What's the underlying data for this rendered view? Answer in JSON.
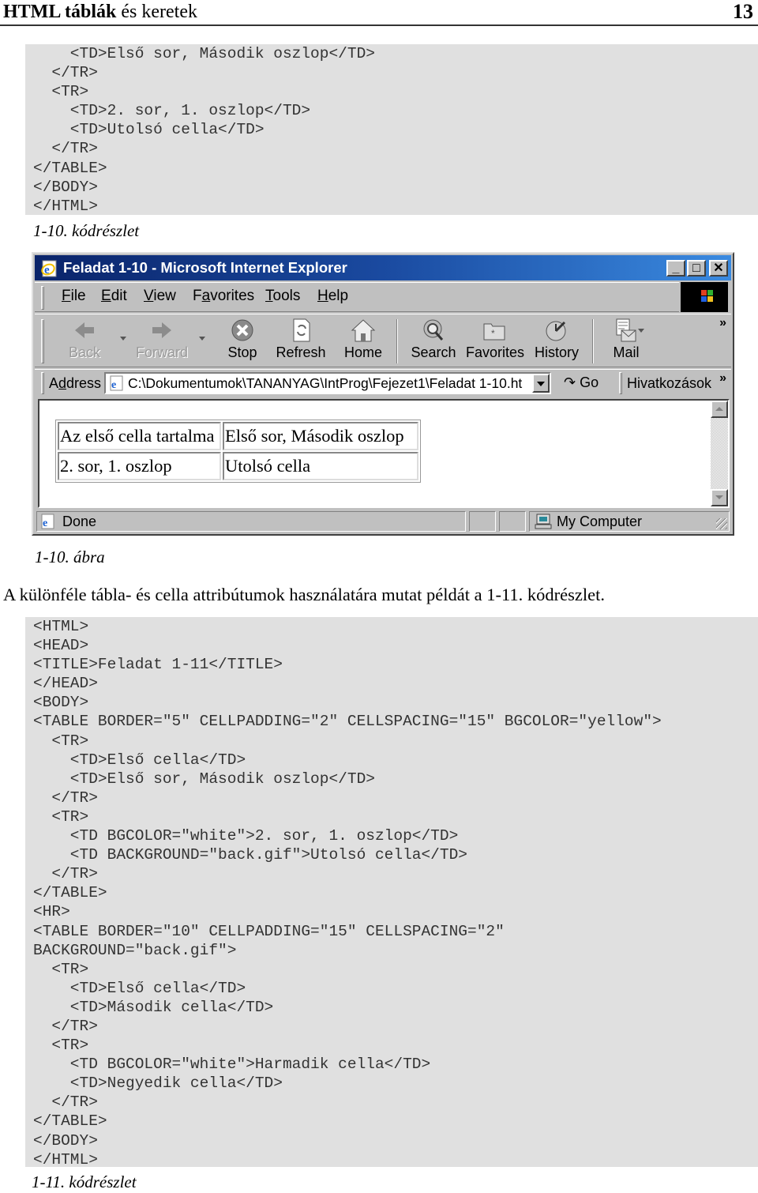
{
  "page_header": {
    "title_bold": "HTML táblák",
    "title_rest": " és keretek",
    "page_number": "13"
  },
  "code_1_10_tail": [
    "    <TD>Első sor, Második oszlop</TD>",
    "  </TR>",
    "  <TR>",
    "    <TD>2. sor, 1. oszlop</TD>",
    "    <TD>Utolsó cella</TD>",
    "  </TR>",
    "</TABLE>",
    "</BODY>",
    "</HTML>"
  ],
  "caption_code_1_10": "1-10. kódrészlet",
  "browser": {
    "title": "Feladat 1-10 - Microsoft Internet Explorer",
    "menu": [
      {
        "label": "File",
        "accel": "F"
      },
      {
        "label": "Edit",
        "accel": "E"
      },
      {
        "label": "View",
        "accel": "V"
      },
      {
        "label": "Favorites",
        "accel": "a"
      },
      {
        "label": "Tools",
        "accel": "T"
      },
      {
        "label": "Help",
        "accel": "H"
      }
    ],
    "toolbar": {
      "back": "Back",
      "forward": "Forward",
      "stop": "Stop",
      "refresh": "Refresh",
      "home": "Home",
      "search": "Search",
      "favorites": "Favorites",
      "history": "History",
      "mail": "Mail",
      "more": "»"
    },
    "address": {
      "label": "Address",
      "value": "C:\\Dokumentumok\\TANANYAG\\IntProg\\Fejezet1\\Feladat 1-10.ht",
      "go": "Go",
      "links": "Hivatkozások",
      "links_more": "»"
    },
    "page_table": [
      [
        "Az első cella tartalma",
        "Első sor, Második oszlop"
      ],
      [
        "2. sor, 1. oszlop",
        "Utolsó cella"
      ]
    ],
    "status": {
      "text": "Done",
      "zone": "My Computer"
    }
  },
  "caption_figure_1_10": "1-10. ábra",
  "paragraph": "A különféle tábla- és cella attribútumok használatára mutat példát a 1-11. kódrészlet.",
  "code_1_11": [
    "<HTML>",
    "<HEAD>",
    "<TITLE>Feladat 1-11</TITLE>",
    "</HEAD>",
    "<BODY>",
    "<TABLE BORDER=\"5\" CELLPADDING=\"2\" CELLSPACING=\"15\" BGCOLOR=\"yellow\">",
    "  <TR>",
    "    <TD>Első cella</TD>",
    "    <TD>Első sor, Második oszlop</TD>",
    "  </TR>",
    "  <TR>",
    "    <TD BGCOLOR=\"white\">2. sor, 1. oszlop</TD>",
    "    <TD BACKGROUND=\"back.gif\">Utolsó cella</TD>",
    "  </TR>",
    "</TABLE>",
    "<HR>",
    "<TABLE BORDER=\"10\" CELLPADDING=\"15\" CELLSPACING=\"2\"",
    "BACKGROUND=\"back.gif\">",
    "  <TR>",
    "    <TD>Első cella</TD>",
    "    <TD>Második cella</TD>",
    "  </TR>",
    "  <TR>",
    "    <TD BGCOLOR=\"white\">Harmadik cella</TD>",
    "    <TD>Negyedik cella</TD>",
    "  </TR>",
    "</TABLE>",
    "</BODY>",
    "</HTML>"
  ],
  "caption_code_1_11": "1-11. kódrészlet",
  "colors": {
    "code_background": "#e0e0e0",
    "title_bar_start": "#0a246a",
    "title_bar_end": "#3a8ae0",
    "window_face": "#c0c0c0"
  }
}
